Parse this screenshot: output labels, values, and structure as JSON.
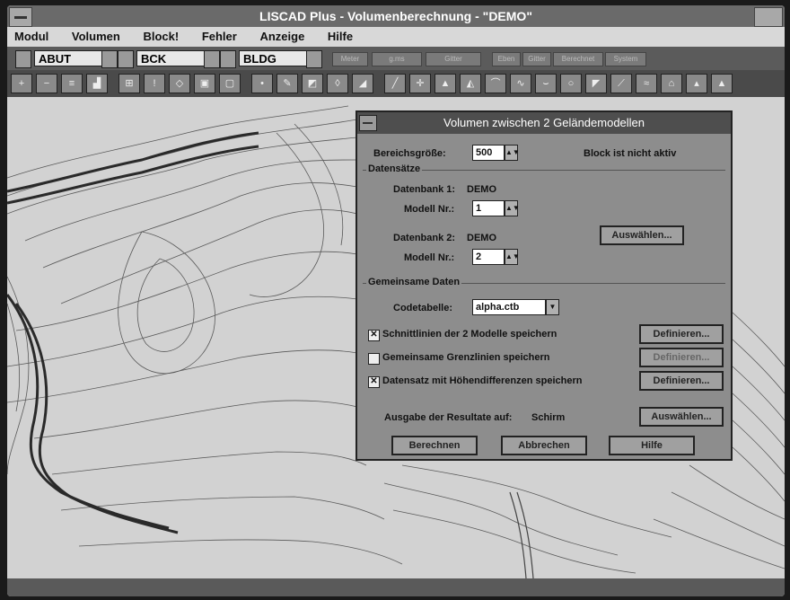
{
  "app": {
    "title": "LISCAD Plus - Volumenberechnung - \"DEMO\""
  },
  "menu": [
    "Modul",
    "Volumen",
    "Block!",
    "Fehler",
    "Anzeige",
    "Hilfe"
  ],
  "toolbar1": {
    "combos": [
      "ABUT",
      "BCK",
      "BLDG"
    ],
    "buttons": [
      "Meter",
      "g.ms",
      "Gitter",
      "Eben",
      "Gitter",
      "Berechnet",
      "System"
    ]
  },
  "dialog": {
    "title": "Volumen zwischen 2 Geländemodellen",
    "bereich_label": "Bereichsgröße:",
    "bereich_value": "500",
    "block_status": "Block ist nicht aktiv",
    "datensaetze_label": "Datensätze",
    "db1_label": "Datenbank 1:",
    "db1_value": "DEMO",
    "modell1_label": "Modell Nr.:",
    "modell1_value": "1",
    "db2_label": "Datenbank 2:",
    "db2_value": "DEMO",
    "modell2_label": "Modell Nr.:",
    "modell2_value": "2",
    "auswaehlen_label": "Auswählen...",
    "gemeinsame_label": "Gemeinsame Daten",
    "codetabelle_label": "Codetabelle:",
    "codetabelle_value": "alpha.ctb",
    "check1_label": "Schnittlinien der 2 Modelle speichern",
    "check1_checked": true,
    "check2_label": "Gemeinsame Grenzlinien speichern",
    "check2_checked": false,
    "check3_label": "Datensatz mit Höhendifferenzen speichern",
    "check3_checked": true,
    "definieren_label": "Definieren...",
    "ausgabe_label": "Ausgabe der Resultate auf:",
    "ausgabe_value": "Schirm",
    "auswaehlen2_label": "Auswählen...",
    "berechnen_label": "Berechnen",
    "abbrechen_label": "Abbrechen",
    "hilfe_label": "Hilfe"
  },
  "colors": {
    "titlebar": "#6a6a6a",
    "dialog_bg": "#8d8d8d",
    "canvas": "#d2d2d2"
  }
}
